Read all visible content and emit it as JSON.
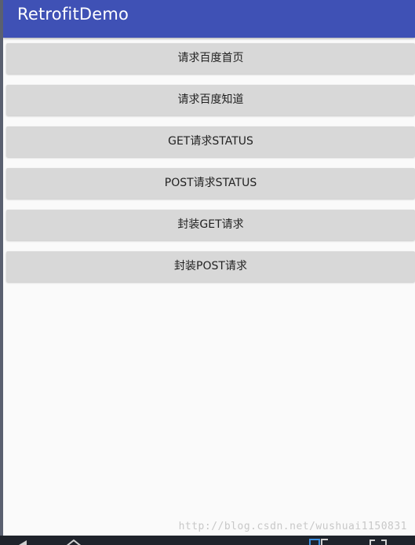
{
  "app_bar": {
    "title": "RetrofitDemo"
  },
  "buttons": [
    {
      "label": "请求百度首页"
    },
    {
      "label": "请求百度知道"
    },
    {
      "label": "GET请求STATUS"
    },
    {
      "label": "POST请求STATUS"
    },
    {
      "label": "封装GET请求"
    },
    {
      "label": "封装POST请求"
    }
  ],
  "watermark": {
    "text": "http://blog.csdn.net/wushuai1150831"
  },
  "colors": {
    "primary": "#3f51b5",
    "background": "#fafafa",
    "button": "#d8d8d8",
    "nav_bar": "#1f232b"
  },
  "nav_bar": {
    "icons": [
      "back-icon",
      "home-icon",
      "recent-apps-icon",
      "screenshot-icon"
    ]
  }
}
